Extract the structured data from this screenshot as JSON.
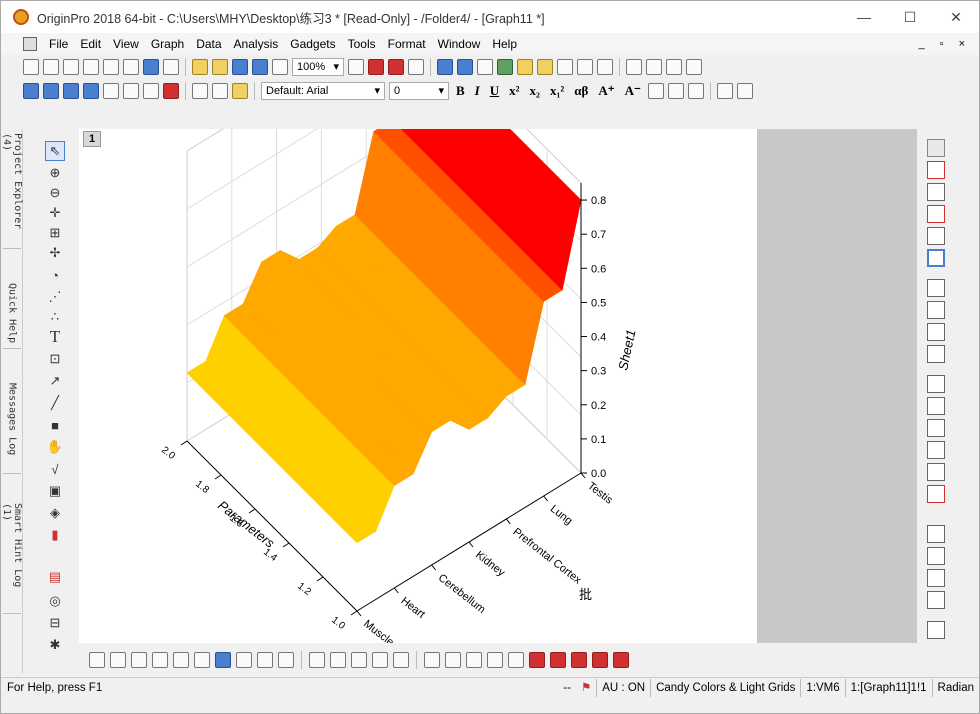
{
  "window": {
    "title": "OriginPro 2018 64-bit - C:\\Users\\MHY\\Desktop\\练习3 * [Read-Only] - /Folder4/ - [Graph11 *]",
    "minimize": "—",
    "maximize": "☐",
    "close": "✕"
  },
  "menubar": {
    "items": [
      "File",
      "Edit",
      "View",
      "Graph",
      "Data",
      "Analysis",
      "Gadgets",
      "Tools",
      "Format",
      "Window",
      "Help"
    ],
    "mdi_controls": "_ ▫ ×"
  },
  "toolbar": {
    "zoom_value": "100%",
    "font_name": "Default: Arial",
    "font_size": "0",
    "bold": "B",
    "italic": "I",
    "underline": "U",
    "superscript": "x²",
    "subscript": "x₂",
    "supsub": "x₁²",
    "greek": "αβ",
    "increase_font": "A⁺",
    "decrease_font": "A⁻"
  },
  "side_tabs": [
    "Project Explorer (4)",
    "Quick Help",
    "Messages Log",
    "Smart Hint Log (1)"
  ],
  "graph": {
    "layer_number": "1",
    "z_axis_title": "Sheet1",
    "x_axis_title": "Parameters",
    "y_axis_title": "批"
  },
  "chart_data": {
    "type": "surface",
    "title": "",
    "x_label": "Parameters",
    "y_label": "批",
    "z_label": "Sheet1",
    "x_ticks": [
      "1.0",
      "1.2",
      "1.4",
      "1.6",
      "1.8",
      "2.0"
    ],
    "x_range": [
      1.0,
      2.0
    ],
    "y_categories": [
      "Muscle",
      "Heart",
      "Cerebellum",
      "Kidney",
      "Prefrontal Cortex",
      "Lung",
      "Testis"
    ],
    "z_ticks": [
      "0.0",
      "0.1",
      "0.2",
      "0.3",
      "0.4",
      "0.5",
      "0.6",
      "0.7",
      "0.8"
    ],
    "z_range": [
      0.0,
      0.85
    ],
    "values_by_category": [
      0.2,
      0.3,
      0.39,
      0.33,
      0.36,
      0.57,
      0.8
    ],
    "colormap": [
      "#ffff00",
      "#ffd000",
      "#ffa800",
      "#ff8000",
      "#ff5000",
      "#ff0000"
    ],
    "grid": true
  },
  "statusbar": {
    "help": "For Help, press F1",
    "flag_text": "--",
    "au": "AU : ON",
    "theme": "Candy Colors & Light Grids",
    "vm": "1:VM6",
    "graph_ref": "1:[Graph11]1!1",
    "angle": "Radian"
  }
}
